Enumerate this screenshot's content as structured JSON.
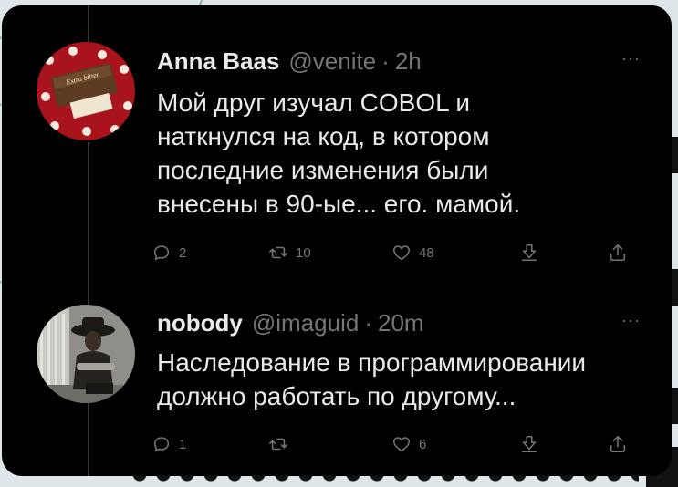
{
  "tweets": [
    {
      "name": "Anna Baas",
      "handle": "@venite",
      "time": "2h",
      "more": "···",
      "lines": [
        "Мой друг изучал COBOL и",
        "наткнулся на код, в котором",
        "последние изменения были",
        "внесены в 90-ые... его. мамой."
      ],
      "stats": {
        "replies": "2",
        "retweets": "10",
        "likes": "48"
      }
    },
    {
      "name": "nobody",
      "handle": "@imaguid",
      "time": "20m",
      "more": "···",
      "lines": [
        "Наследование в программировании",
        "должно работать по другому..."
      ],
      "stats": {
        "replies": "1",
        "retweets": "",
        "likes": "6"
      }
    }
  ],
  "separator": "·",
  "colors": {
    "background": "#000000",
    "text": "#e7e9ea",
    "muted": "#71767b",
    "thread_line": "#333639"
  },
  "icons": [
    "reply-icon",
    "retweet-icon",
    "like-icon",
    "bookmark-icon",
    "share-icon",
    "more-icon"
  ]
}
